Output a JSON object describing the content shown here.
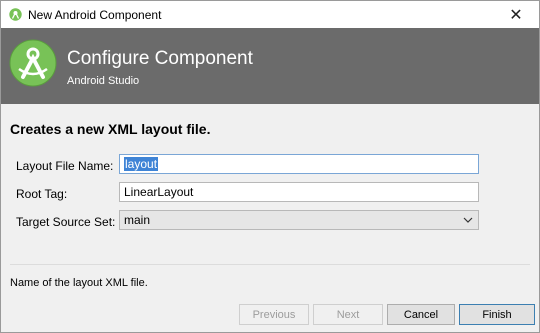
{
  "window": {
    "title": "New Android Component"
  },
  "banner": {
    "title": "Configure Component",
    "subtitle": "Android Studio"
  },
  "form": {
    "heading": "Creates a new XML layout file.",
    "layout_file_name": {
      "label": "Layout File Name:",
      "value": "layout"
    },
    "root_tag": {
      "label": "Root Tag:",
      "value": "LinearLayout"
    },
    "target_source_set": {
      "label": "Target Source Set:",
      "value": "main"
    }
  },
  "hint": "Name of the layout XML file.",
  "buttons": {
    "previous": "Previous",
    "next": "Next",
    "cancel": "Cancel",
    "finish": "Finish"
  },
  "colors": {
    "banner_bg": "#6b6b6b",
    "logo_green": "#78c257",
    "selection": "#3f84d6"
  },
  "icons": {
    "title": "android-studio-icon",
    "close": "close-icon",
    "logo": "android-studio-logo",
    "dropdown": "chevron-down-icon"
  }
}
